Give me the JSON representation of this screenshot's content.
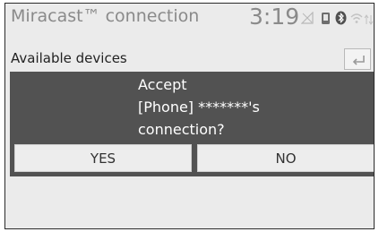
{
  "header": {
    "title": "Miracast™ connection",
    "time": "3:19"
  },
  "list": {
    "header": "Available devices"
  },
  "dialog": {
    "line1": "Accept",
    "line2": "[Phone] *******'s",
    "line3": "connection?",
    "yes_label": "YES",
    "no_label": "NO"
  },
  "icons": [
    "phone-icon",
    "bluetooth-icon",
    "wifi-icon",
    "signal-icon",
    "back-icon"
  ]
}
